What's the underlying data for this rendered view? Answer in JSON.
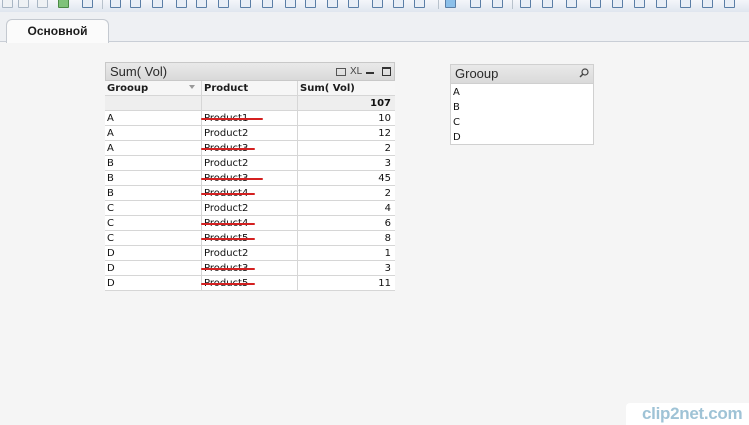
{
  "sheet": {
    "active_tab": "Основной"
  },
  "table": {
    "title": "Sum( Vol)",
    "xl_label": "XL",
    "columns": [
      "Grooup",
      "Product",
      "Sum( Vol)"
    ],
    "total": "107",
    "rows": [
      {
        "group": "A",
        "product": "Product1",
        "vol": "10",
        "struck": true
      },
      {
        "group": "A",
        "product": "Product2",
        "vol": "12",
        "struck": false
      },
      {
        "group": "A",
        "product": "Product3",
        "vol": "2",
        "struck": true
      },
      {
        "group": "B",
        "product": "Product2",
        "vol": "3",
        "struck": false
      },
      {
        "group": "B",
        "product": "Product3",
        "vol": "45",
        "struck": true
      },
      {
        "group": "B",
        "product": "Product4",
        "vol": "2",
        "struck": true
      },
      {
        "group": "C",
        "product": "Product2",
        "vol": "4",
        "struck": false
      },
      {
        "group": "C",
        "product": "Product4",
        "vol": "6",
        "struck": true
      },
      {
        "group": "C",
        "product": "Product5",
        "vol": "8",
        "struck": true
      },
      {
        "group": "D",
        "product": "Product2",
        "vol": "1",
        "struck": false
      },
      {
        "group": "D",
        "product": "Product3",
        "vol": "3",
        "struck": true
      },
      {
        "group": "D",
        "product": "Product5",
        "vol": "11",
        "struck": true
      }
    ],
    "annotation_color": "#d42020"
  },
  "listbox": {
    "title": "Grooup",
    "items": [
      "A",
      "B",
      "C",
      "D"
    ]
  },
  "watermark": {
    "text": "clip2net.com"
  },
  "colors": {
    "background": "#f5f5f5",
    "caption": "#dadada",
    "grid_line": "#d6d6d6"
  }
}
